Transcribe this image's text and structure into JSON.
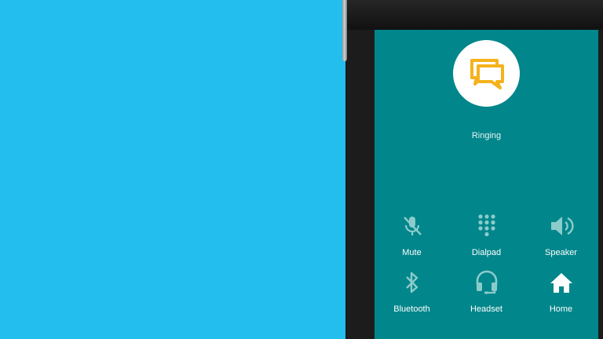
{
  "call": {
    "status": "Ringing",
    "avatar_icon": "chat-bubbles-icon",
    "colors": {
      "background": "#23BDEE",
      "screen": "#00868B",
      "avatar_icon": "#F5B21C",
      "icon_dimmed": "#8CCBCB",
      "icon_active": "#FFFFFF"
    }
  },
  "controls": [
    {
      "label": "Mute",
      "icon": "mic-off-icon",
      "enabled": false
    },
    {
      "label": "Dialpad",
      "icon": "dialpad-icon",
      "enabled": false
    },
    {
      "label": "Speaker",
      "icon": "speaker-icon",
      "enabled": false
    },
    {
      "label": "Bluetooth",
      "icon": "bluetooth-icon",
      "enabled": false
    },
    {
      "label": "Headset",
      "icon": "headset-icon",
      "enabled": false
    },
    {
      "label": "Home",
      "icon": "home-icon",
      "enabled": true
    }
  ]
}
